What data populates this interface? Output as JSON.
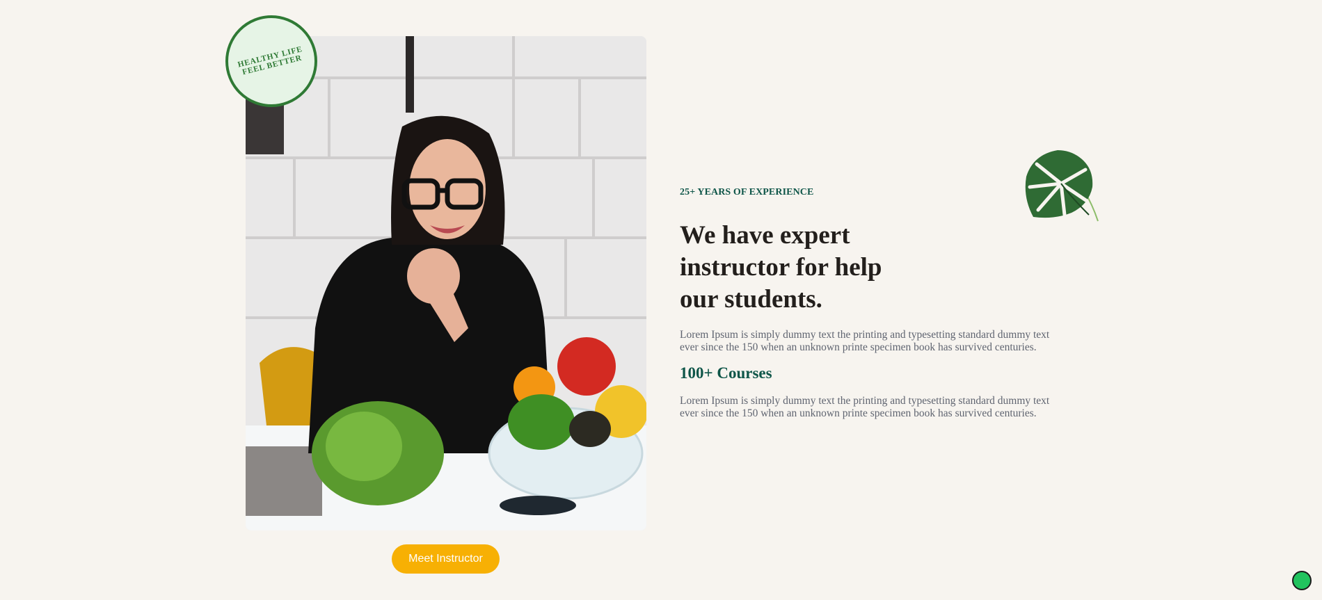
{
  "badge": {
    "line1": "HEALTHY LIFE",
    "line2": "FEEL BETTER"
  },
  "hero_image": {
    "icon": "instructor-photo"
  },
  "cta": {
    "label": "Meet Instructor"
  },
  "about": {
    "eyebrow": "25+ YEARS OF EXPERIENCE",
    "heading_line1": "We have expert",
    "heading_line2": "instructor for help",
    "heading_line3": "our students.",
    "paragraph1": "Lorem Ipsum is simply dummy text the printing and typesetting standard dummy text ever since the 150 when an unknown printe specimen book has survived centuries.",
    "courses": "100+ Courses",
    "paragraph2": "Lorem Ipsum is simply dummy text the printing and typesetting standard dummy text ever since the 150 when an unknown printe specimen book has survived centuries."
  },
  "decor": {
    "leaf_icon": "monstera-leaf-icon",
    "chat_icon": "chat-widget-icon"
  },
  "colors": {
    "background": "#f7f4ef",
    "brand_green": "#2f7a35",
    "heading_teal": "#0e5548",
    "cta_yellow": "#f7b004",
    "chat_green": "#21c35e"
  }
}
